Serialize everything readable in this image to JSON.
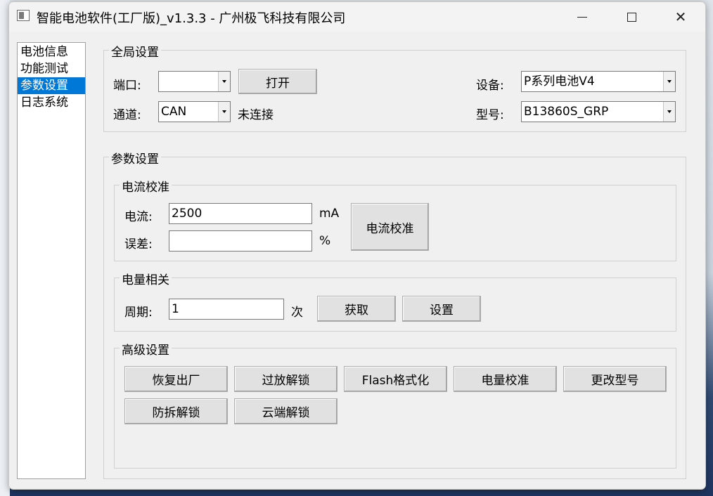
{
  "window": {
    "title": "智能电池软件(工厂版)_v1.3.3 - 广州极飞科技有限公司",
    "controls": {
      "minimize": "",
      "maximize": "",
      "close": "✕"
    }
  },
  "nav": {
    "items": [
      {
        "label": "电池信息",
        "selected": false
      },
      {
        "label": "功能测试",
        "selected": false
      },
      {
        "label": "参数设置",
        "selected": true
      },
      {
        "label": "日志系统",
        "selected": false
      }
    ]
  },
  "global": {
    "title": "全局设置",
    "port_label": "端口:",
    "port_value": "",
    "open_button": "打开",
    "channel_label": "通道:",
    "channel_value": "CAN",
    "status": "未连接",
    "device_label": "设备:",
    "device_value": "P系列电池V4",
    "model_label": "型号:",
    "model_value": "B13860S_GRP"
  },
  "params": {
    "title": "参数设置",
    "current_cal": {
      "title": "电流校准",
      "current_label": "电流:",
      "current_value": "2500",
      "current_unit": "mA",
      "error_label": "误差:",
      "error_value": "",
      "error_unit": "%",
      "calibrate_button": "电流校准"
    },
    "capacity": {
      "title": "电量相关",
      "cycle_label": "周期:",
      "cycle_value": "1",
      "cycle_unit": "次",
      "get_button": "获取",
      "set_button": "设置"
    },
    "advanced": {
      "title": "高级设置",
      "buttons": [
        "恢复出厂",
        "过放解锁",
        "Flash格式化",
        "电量校准",
        "更改型号",
        "防拆解锁",
        "云端解锁"
      ]
    }
  }
}
